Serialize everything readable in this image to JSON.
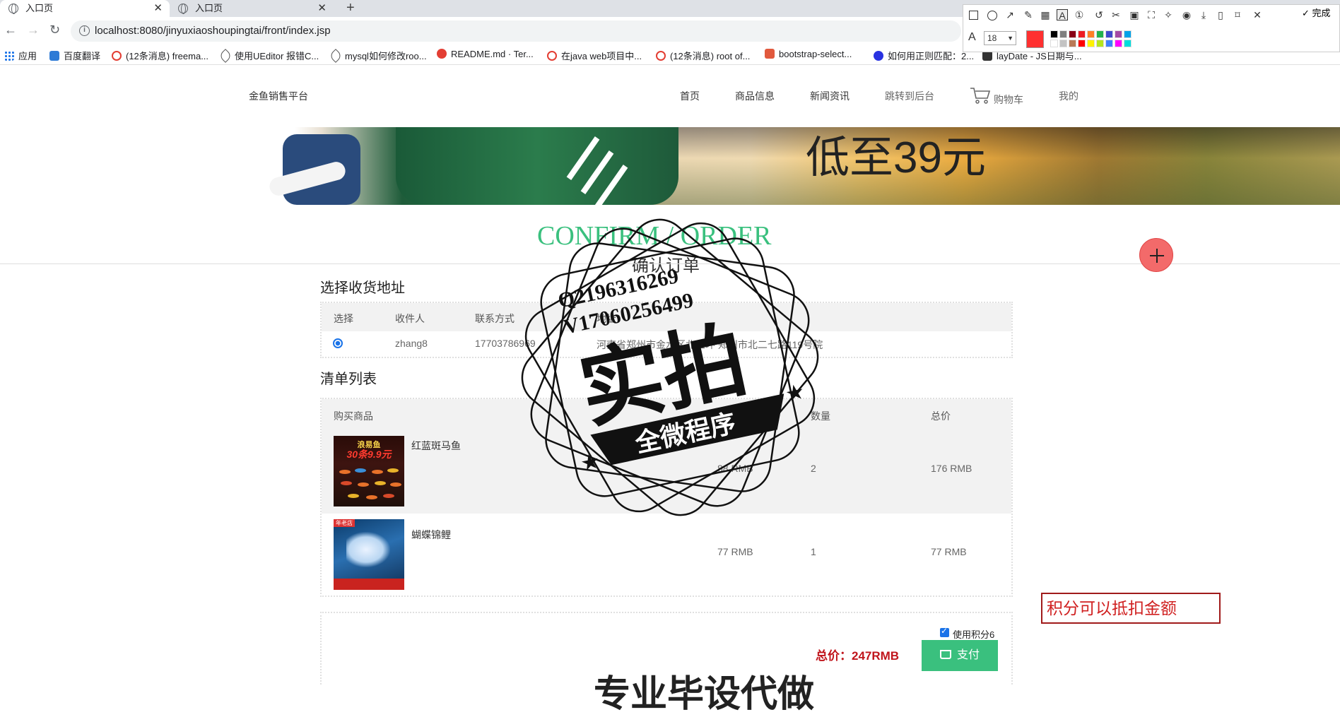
{
  "browser": {
    "tabs": [
      {
        "label": "入口页",
        "active": true
      },
      {
        "label": "入口页",
        "active": false
      }
    ],
    "url": "localhost:8080/jinyuxiaoshoupingtai/front/index.jsp",
    "bookmarks": [
      {
        "label": "应用",
        "icon": "apps-grid-icon"
      },
      {
        "label": "百度翻译",
        "icon": "baidu-translate-icon"
      },
      {
        "label": "(12条消息) freema...",
        "icon": "csdn-icon"
      },
      {
        "label": "使用UEditor 报错C...",
        "icon": "feather-icon"
      },
      {
        "label": "mysql如何修改roo...",
        "icon": "feather-icon"
      },
      {
        "label": "README.md · Ter...",
        "icon": "gitee-icon"
      },
      {
        "label": "在java web项目中...",
        "icon": "csdn-icon"
      },
      {
        "label": "(12条消息) root of...",
        "icon": "csdn-icon"
      },
      {
        "label": "bootstrap-select...",
        "icon": "jianshu-icon"
      },
      {
        "label": "如何用正则匹配：2...",
        "icon": "baidu-paw-icon"
      },
      {
        "label": "layDate - JS日期与...",
        "icon": "calendar-icon"
      }
    ]
  },
  "screenshot_tool": {
    "done_label": "完成",
    "font_size": "18",
    "current_color": "#ff3030",
    "palette": [
      "#000000",
      "#7f7f7f",
      "#880015",
      "#ed1c24",
      "#ff7f27",
      "#22b14c",
      "#3f48cc",
      "#a349a4",
      "#00a2e8",
      "#ffffff",
      "#c3c3c3",
      "#b97a57",
      "#ff0000",
      "#fff200",
      "#b5e61d",
      "#3f7fff",
      "#ff00ff",
      "#00dddd"
    ]
  },
  "site": {
    "logo": "金鱼销售平台",
    "nav": [
      "首页",
      "商品信息",
      "新闻资讯",
      "跳转到后台",
      "购物车",
      "我的"
    ]
  },
  "banner": {
    "text": "低至39元"
  },
  "section": {
    "title_en": "CONFIRM / ORDER",
    "title_cn": "确认订单"
  },
  "address": {
    "title": "选择收货地址",
    "headers": [
      "选择",
      "收件人",
      "联系方式",
      "地址"
    ],
    "rows": [
      {
        "selected": true,
        "name": "zhang8",
        "phone": "17703786969",
        "address": "河南省郑州市金水区北三环 郑州市北二七路119号院"
      }
    ]
  },
  "items": {
    "title": "清单列表",
    "headers": [
      "购买商品",
      "单价",
      "数量",
      "总价"
    ],
    "rows": [
      {
        "name": "红蓝斑马鱼",
        "price": "88 RMB",
        "qty": "2",
        "total": "176 RMB",
        "thumb_line1": "浪易鱼",
        "thumb_line2": "30条9.9元"
      },
      {
        "name": "蝴蝶锦鲤",
        "price": "77 RMB",
        "qty": "1",
        "total": "77 RMB",
        "thumb_tag": "年老店"
      }
    ]
  },
  "checkout": {
    "points_label": "使用积分6",
    "points_checked": true,
    "total": "总价：247RMB",
    "pay_label": "支付"
  },
  "annotation": "积分可以抵扣金额",
  "watermark": {
    "line1": "Q2196316269",
    "line2": "V17060256499",
    "big": "实拍",
    "ribbon": "全微程序"
  },
  "bottom_text": "专业毕设代做"
}
